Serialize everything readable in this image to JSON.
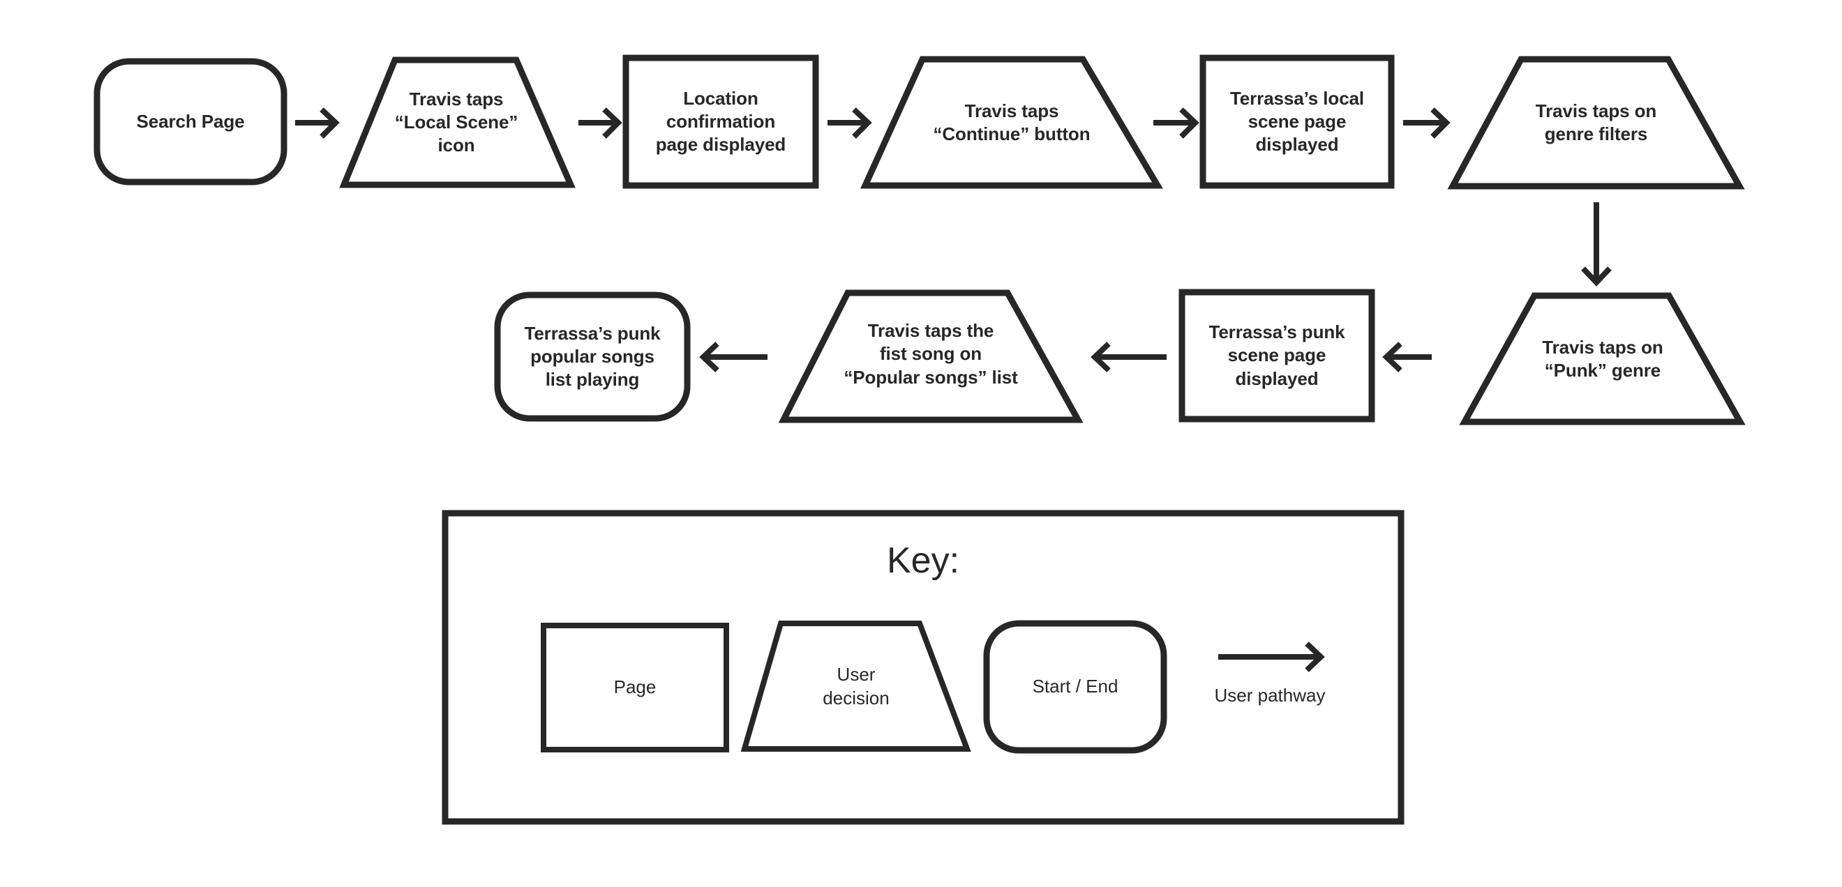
{
  "diagram": {
    "title_visible": false,
    "stroke_color": "#272727",
    "fill_color": "#ffffff",
    "nodes": [
      {
        "id": "n1",
        "shape": "start-end",
        "label": "Search Page"
      },
      {
        "id": "n2",
        "shape": "user-decision",
        "label": "Travis taps\n“Local Scene”\nicon"
      },
      {
        "id": "n3",
        "shape": "page",
        "label": "Location\nconfirmation\npage displayed"
      },
      {
        "id": "n4",
        "shape": "user-decision",
        "label": "Travis taps\n“Continue” button"
      },
      {
        "id": "n5",
        "shape": "page",
        "label": "Terrassa’s local\nscene page\ndisplayed"
      },
      {
        "id": "n6",
        "shape": "user-decision",
        "label": "Travis taps on\ngenre filters"
      },
      {
        "id": "n7",
        "shape": "user-decision",
        "label": "Travis taps on\n“Punk” genre"
      },
      {
        "id": "n8",
        "shape": "page",
        "label": "Terrassa’s punk\nscene page\ndisplayed"
      },
      {
        "id": "n9",
        "shape": "user-decision",
        "label": "Travis taps the\nfist song on\n“Popular songs” list"
      },
      {
        "id": "n10",
        "shape": "start-end",
        "label": "Terrassa’s punk\npopular songs\nlist playing"
      }
    ],
    "connectors": [
      {
        "from": "n1",
        "to": "n2",
        "direction": "right"
      },
      {
        "from": "n2",
        "to": "n3",
        "direction": "right"
      },
      {
        "from": "n3",
        "to": "n4",
        "direction": "right"
      },
      {
        "from": "n4",
        "to": "n5",
        "direction": "right"
      },
      {
        "from": "n5",
        "to": "n6",
        "direction": "right"
      },
      {
        "from": "n6",
        "to": "n7",
        "direction": "down"
      },
      {
        "from": "n7",
        "to": "n8",
        "direction": "left"
      },
      {
        "from": "n8",
        "to": "n9",
        "direction": "left"
      },
      {
        "from": "n9",
        "to": "n10",
        "direction": "left"
      }
    ]
  },
  "key": {
    "title": "Key:",
    "items": [
      {
        "shape": "page",
        "label": "Page"
      },
      {
        "shape": "user-decision",
        "label": "User\ndecision"
      },
      {
        "shape": "start-end",
        "label": "Start / End"
      },
      {
        "shape": "arrow",
        "label": "User pathway"
      }
    ]
  }
}
